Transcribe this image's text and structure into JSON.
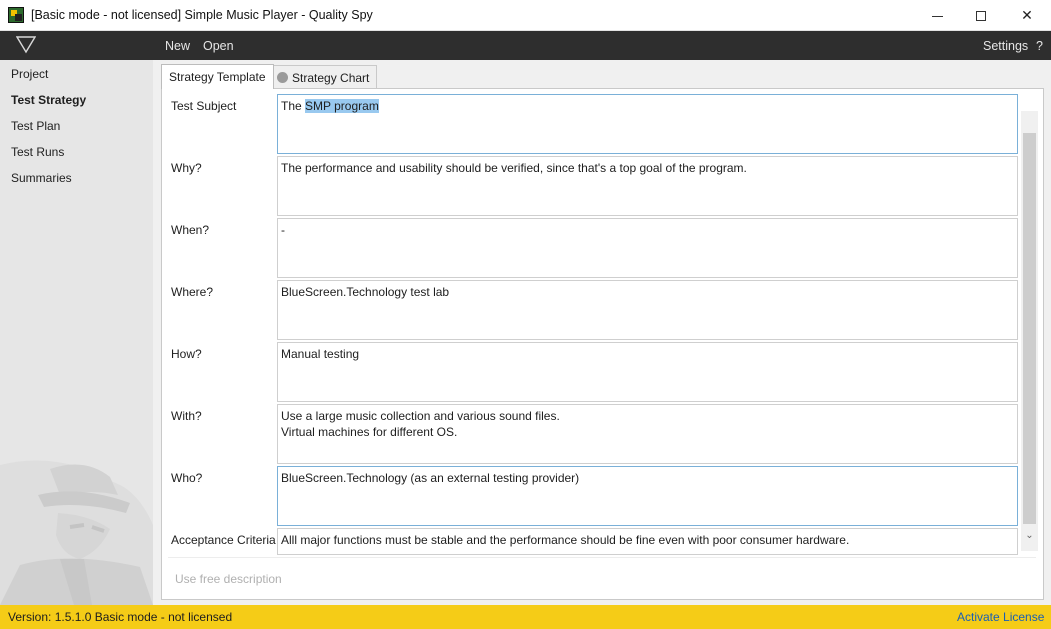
{
  "window": {
    "title": "[Basic mode - not licensed] Simple Music Player - Quality Spy",
    "minimize_glyph": "",
    "maximize_glyph": "",
    "close_glyph": "✕"
  },
  "menubar": {
    "new_label": "New",
    "open_label": "Open",
    "settings_label": "Settings",
    "help_label": "?"
  },
  "sidebar": {
    "items": [
      {
        "label": "Project"
      },
      {
        "label": "Test Strategy"
      },
      {
        "label": "Test Plan"
      },
      {
        "label": "Test Runs"
      },
      {
        "label": "Summaries"
      }
    ],
    "active": "Test Strategy"
  },
  "tabs": [
    {
      "label": "Strategy Template",
      "active": true
    },
    {
      "label": "Strategy Chart",
      "active": false
    }
  ],
  "strategy": {
    "fields": [
      {
        "label": "Test Subject",
        "value_prefix": "The ",
        "value_selected": "SMP program",
        "focused": true
      },
      {
        "label": "Why?",
        "value": "The performance and usability should be verified, since that's a top goal of the program."
      },
      {
        "label": "When?",
        "value": "-"
      },
      {
        "label": "Where?",
        "value": "BlueScreen.Technology test lab"
      },
      {
        "label": "How?",
        "value": "Manual testing"
      },
      {
        "label": "With?",
        "value": "Use a large music collection and various sound files.\nVirtual machines for different OS."
      },
      {
        "label": "Who?",
        "value": "BlueScreen.Technology (as an external testing provider)",
        "focused": true
      },
      {
        "label": "Acceptance Criteria",
        "value": "Alll major functions must be stable and the performance should be fine even with poor consumer hardware."
      }
    ],
    "free_description_label": "Use free description"
  },
  "statusbar": {
    "text": "Version: 1.5.1.0  Basic mode - not licensed",
    "activate_label": "Activate License"
  },
  "colors": {
    "menubar_bg": "#2e2e2e",
    "sidebar_bg": "#e6e6e6",
    "statusbar_bg": "#f5cc17",
    "selection": "#99c9ef",
    "link": "#1a5fb4"
  }
}
